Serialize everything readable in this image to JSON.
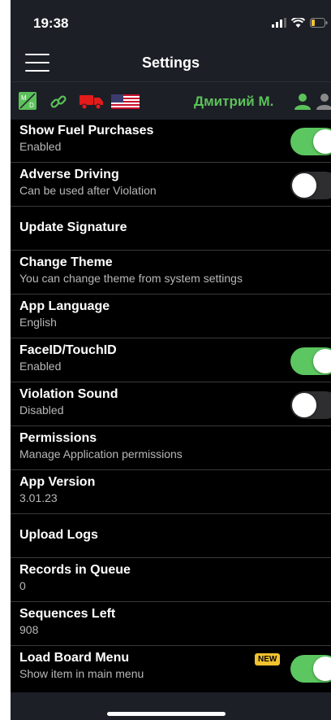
{
  "status_bar": {
    "time": "19:38"
  },
  "header": {
    "title": "Settings"
  },
  "info_bar": {
    "duty_status_icon": "md-duty-icon",
    "driver_name": "Дмитрий  М.",
    "colors": {
      "accent": "#5cc15a",
      "truck": "#e21b1b"
    }
  },
  "settings": [
    {
      "id": "fuel",
      "title": "Show Fuel Purchases",
      "subtitle": "Enabled",
      "toggle": true
    },
    {
      "id": "adverse",
      "title": "Adverse Driving",
      "subtitle": "Can be used after Violation",
      "toggle": false
    },
    {
      "id": "signature",
      "title": "Update Signature"
    },
    {
      "id": "theme",
      "title": "Change Theme",
      "subtitle": "You can change theme from system settings"
    },
    {
      "id": "language",
      "title": "App Language",
      "subtitle": "English"
    },
    {
      "id": "faceid",
      "title": "FaceID/TouchID",
      "subtitle": "Enabled",
      "toggle": true
    },
    {
      "id": "violation-sound",
      "title": "Violation Sound",
      "subtitle": "Disabled",
      "toggle": false
    },
    {
      "id": "permissions",
      "title": "Permissions",
      "subtitle": "Manage Application permissions"
    },
    {
      "id": "app-version",
      "title": "App Version",
      "subtitle": "3.01.23"
    },
    {
      "id": "upload-logs",
      "title": "Upload Logs"
    },
    {
      "id": "records-queue",
      "title": "Records in Queue",
      "subtitle": "0"
    },
    {
      "id": "sequences",
      "title": "Sequences Left",
      "subtitle": "908"
    },
    {
      "id": "load-board",
      "title": "Load Board Menu",
      "subtitle": "Show item in main menu",
      "toggle": true,
      "badge": "NEW"
    }
  ]
}
